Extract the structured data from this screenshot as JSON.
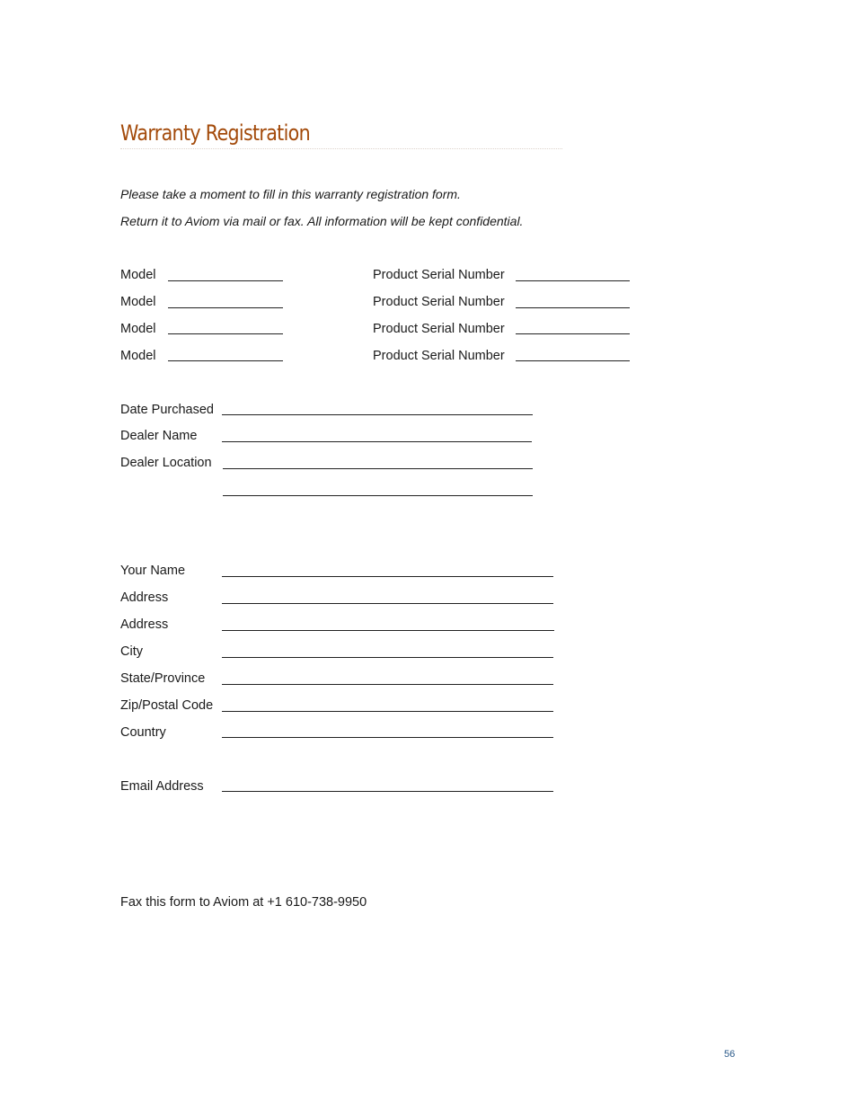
{
  "page": {
    "title": "Warranty Registration",
    "intro": [
      "Please take a moment to fill in this warranty registration form.",
      "Return it to Aviom via mail or fax. All information will be kept confidential."
    ],
    "products": [
      {
        "model_label": "Model",
        "serial_label": "Product Serial Number"
      },
      {
        "model_label": "Model",
        "serial_label": "Product Serial Number"
      },
      {
        "model_label": "Model",
        "serial_label": "Product Serial Number"
      },
      {
        "model_label": "Model",
        "serial_label": "Product Serial Number"
      }
    ],
    "purchase": {
      "date_label": "Date Purchased",
      "dealer_name_label": "Dealer Name",
      "dealer_location_label": "Dealer Location"
    },
    "contact": {
      "name_label": "Your Name",
      "address1_label": "Address",
      "address2_label": "Address",
      "city_label": "City",
      "state_label": "State/Province",
      "zip_label": "Zip/Postal Code",
      "country_label": "Country",
      "email_label": "Email Address"
    },
    "footer_text": "Fax this form to Aviom at +1 610-738-9950",
    "page_number": "56"
  }
}
